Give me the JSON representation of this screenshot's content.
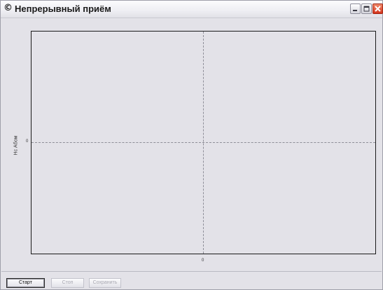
{
  "window": {
    "title": "Непрерывный приём",
    "icon": "app-icon"
  },
  "plot": {
    "y_label": "Нс Абом",
    "y_tick": "0",
    "x_tick": "0"
  },
  "buttons": {
    "start": "Старт",
    "stop": "Стоп",
    "save": "Сохранить"
  },
  "colors": {
    "background": "#e3e2e8",
    "close_button": "#d3331c",
    "grid": "#8e8e98",
    "disabled_text": "#a9a9b2"
  }
}
